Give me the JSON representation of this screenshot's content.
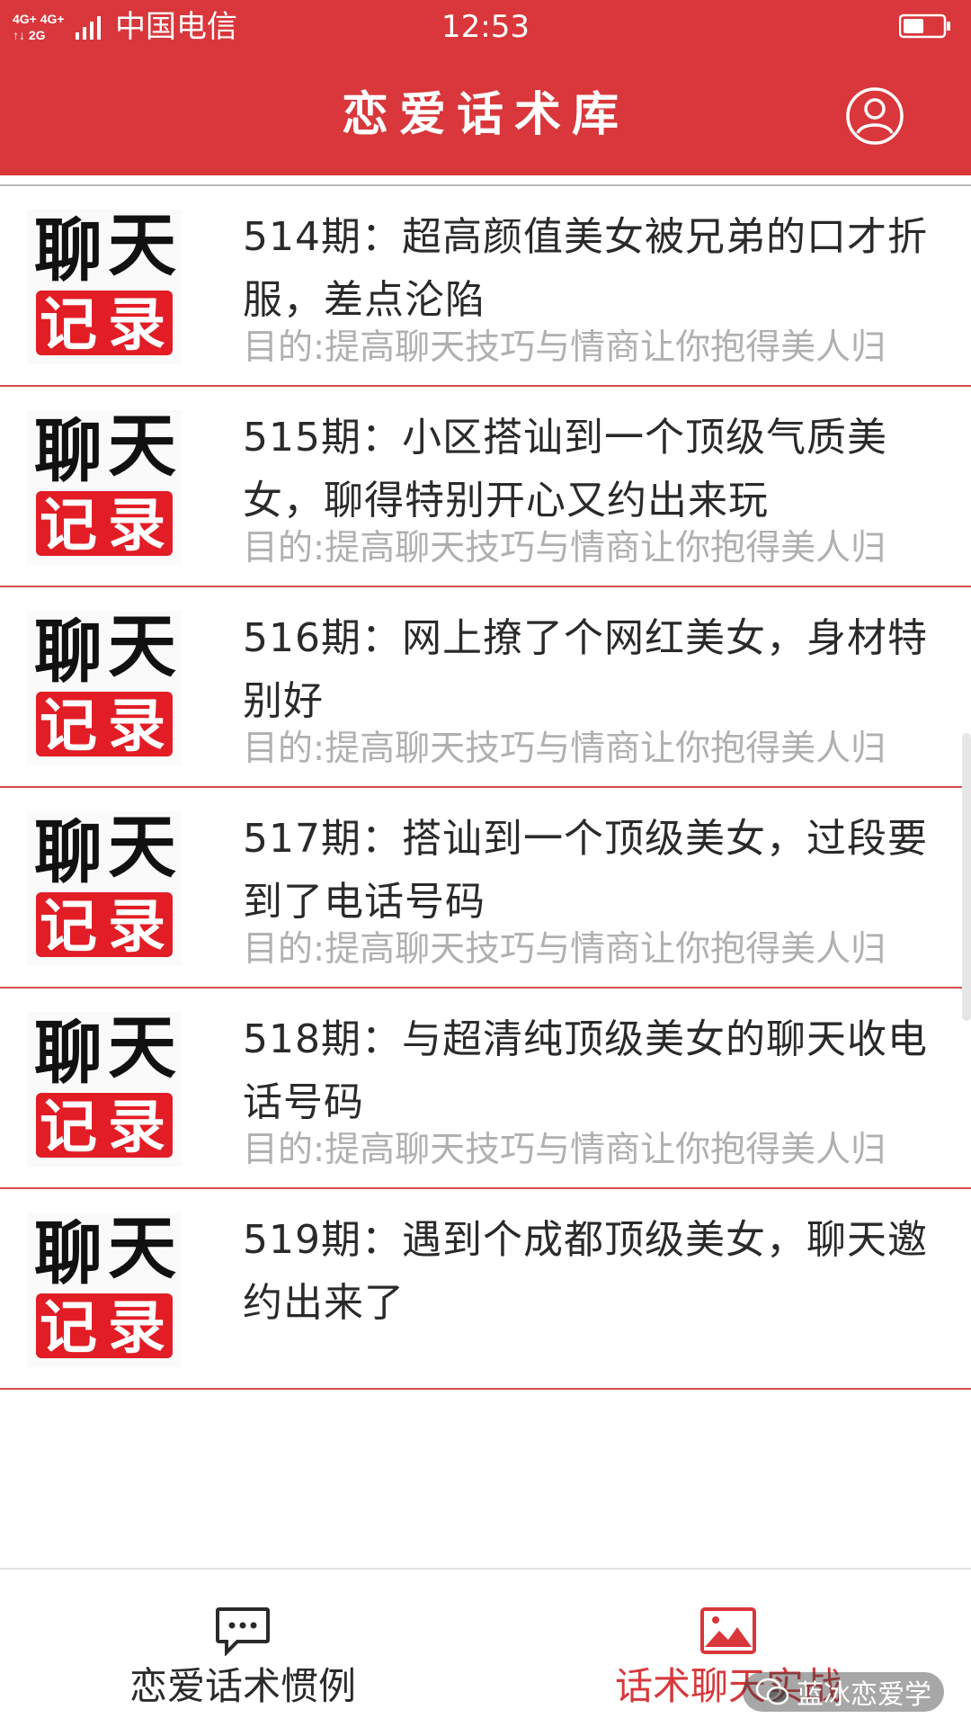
{
  "status_bar": {
    "network": "4G⁺ 4G⁺ 2G",
    "carrier": "中国电信",
    "time": "12:53"
  },
  "header": {
    "title": "恋爱话术库"
  },
  "thumbnail": {
    "line1": [
      "聊",
      "天"
    ],
    "line2": [
      "记",
      "录"
    ]
  },
  "items": [
    {
      "title": "514期：超高颜值美女被兄弟的口才折服，差点沦陷",
      "desc": "目的:提高聊天技巧与情商让你抱得美人归"
    },
    {
      "title": "515期：小区搭讪到一个顶级气质美女，聊得特别开心又约出来玩",
      "desc": "目的:提高聊天技巧与情商让你抱得美人归"
    },
    {
      "title": "516期：网上撩了个网红美女，身材特别好",
      "desc": "目的:提高聊天技巧与情商让你抱得美人归"
    },
    {
      "title": "517期：搭讪到一个顶级美女，过段要到了电话号码",
      "desc": "目的:提高聊天技巧与情商让你抱得美人归"
    },
    {
      "title": "518期：与超清纯顶级美女的聊天收电话号码",
      "desc": "目的:提高聊天技巧与情商让你抱得美人归"
    },
    {
      "title": "519期：遇到个成都顶级美女，聊天邀约出来了",
      "desc": ""
    }
  ],
  "bottom_nav": {
    "tab_left": {
      "label": "恋爱话术惯例",
      "icon": "chat-bubble-icon"
    },
    "tab_right": {
      "label": "话术聊天实战",
      "icon": "image-icon",
      "active": true
    }
  },
  "watermark": "蓝冰恋爱学",
  "colors": {
    "brand_red": "#d9373b",
    "divider_red": "#d94c4c",
    "muted_text": "#b0b0b0"
  }
}
